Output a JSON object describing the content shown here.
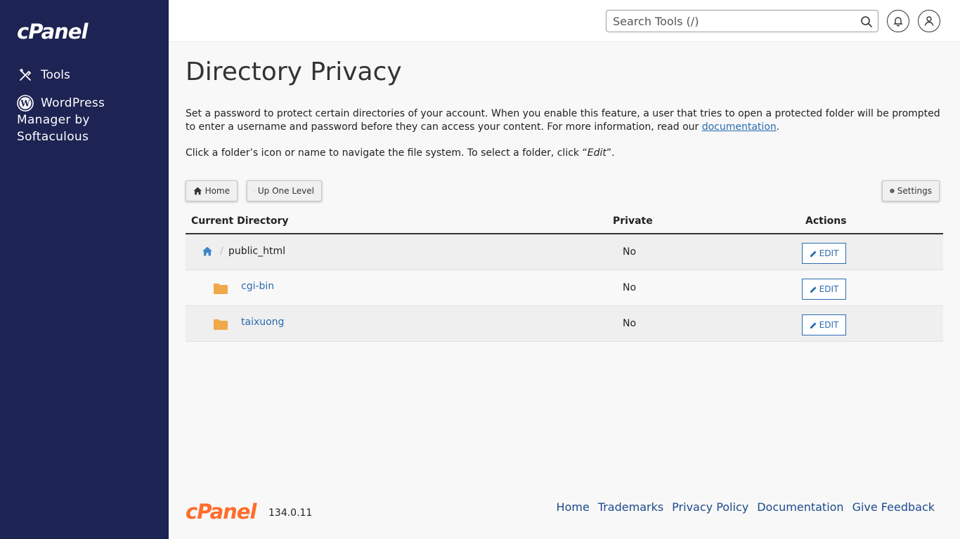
{
  "brand": {
    "logo_text": "cPanel",
    "accent": "#ff6c2c",
    "sidebar_bg": "#1d2352"
  },
  "sidebar": {
    "items": [
      {
        "label": "Tools",
        "icon": "tools-icon"
      },
      {
        "label": "WordPress Manager by Softaculous",
        "icon": "wordpress-icon"
      }
    ]
  },
  "header": {
    "search_placeholder": "Search Tools (/)",
    "notifications_icon": "bell-icon",
    "user_icon": "user-icon"
  },
  "page": {
    "title": "Directory Privacy",
    "description_prefix": "Set a password to protect certain directories of your account. When you enable this feature, a user that tries to open a protected folder will be prompted to enter a username and password before they can access your content. For more information, read our ",
    "doc_link": "documentation",
    "description_suffix": ".",
    "nav_hint_prefix": "Click a folder’s icon or name to navigate the file system. To select a folder, click “",
    "nav_hint_em": "Edit",
    "nav_hint_suffix": "”."
  },
  "toolbar": {
    "home_label": "Home",
    "up_label": "Up One Level",
    "settings_label": "Settings"
  },
  "table": {
    "headers": {
      "directory": "Current Directory",
      "private": "Private",
      "actions": "Actions"
    },
    "current": {
      "separator": "/",
      "name": "public_html",
      "private": "No",
      "action": "EDIT"
    },
    "rows": [
      {
        "name": "cgi-bin",
        "private": "No",
        "action": "EDIT"
      },
      {
        "name": "taixuong",
        "private": "No",
        "action": "EDIT"
      }
    ]
  },
  "footer": {
    "logo_text": "cPanel",
    "version": "134.0.11",
    "links": [
      "Home",
      "Trademarks",
      "Privacy Policy",
      "Documentation",
      "Give Feedback"
    ]
  }
}
